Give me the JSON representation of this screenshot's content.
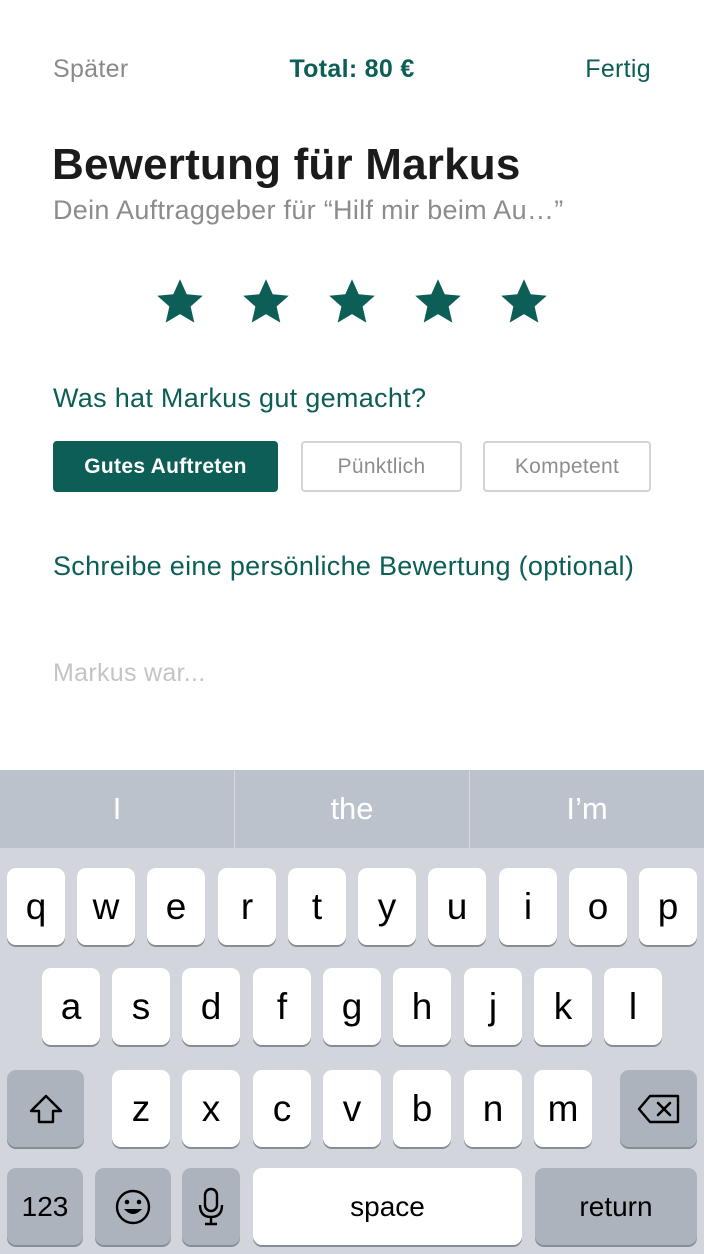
{
  "header": {
    "later_label": "Später",
    "total_label": "Total: 80 €",
    "done_label": "Fertig"
  },
  "rating": {
    "title": "Bewertung für Markus",
    "subtitle": "Dein Auftraggeber für “Hilf mir beim Au…”",
    "stars_selected": 5,
    "stars_total": 5,
    "star_color": "#0c5e56"
  },
  "praise": {
    "question": "Was hat Markus gut gemacht?",
    "tags": [
      {
        "label": "Gutes Auftreten",
        "selected": true
      },
      {
        "label": "Pünktlich",
        "selected": false
      },
      {
        "label": "Kompetent",
        "selected": false
      }
    ]
  },
  "review": {
    "prompt": "Schreibe eine persönliche Bewertung (optional)",
    "placeholder": "Markus war...",
    "value": ""
  },
  "keyboard": {
    "suggestions": [
      "I",
      "the",
      "I’m"
    ],
    "row1": [
      "q",
      "w",
      "e",
      "r",
      "t",
      "y",
      "u",
      "i",
      "o",
      "p"
    ],
    "row2": [
      "a",
      "s",
      "d",
      "f",
      "g",
      "h",
      "j",
      "k",
      "l"
    ],
    "row3": [
      "z",
      "x",
      "c",
      "v",
      "b",
      "n",
      "m"
    ],
    "numbers_label": "123",
    "space_label": "space",
    "return_label": "return"
  },
  "colors": {
    "accent": "#0c5e56",
    "muted_text": "#8c8c8c",
    "keyboard_bg": "#d2d5db"
  }
}
